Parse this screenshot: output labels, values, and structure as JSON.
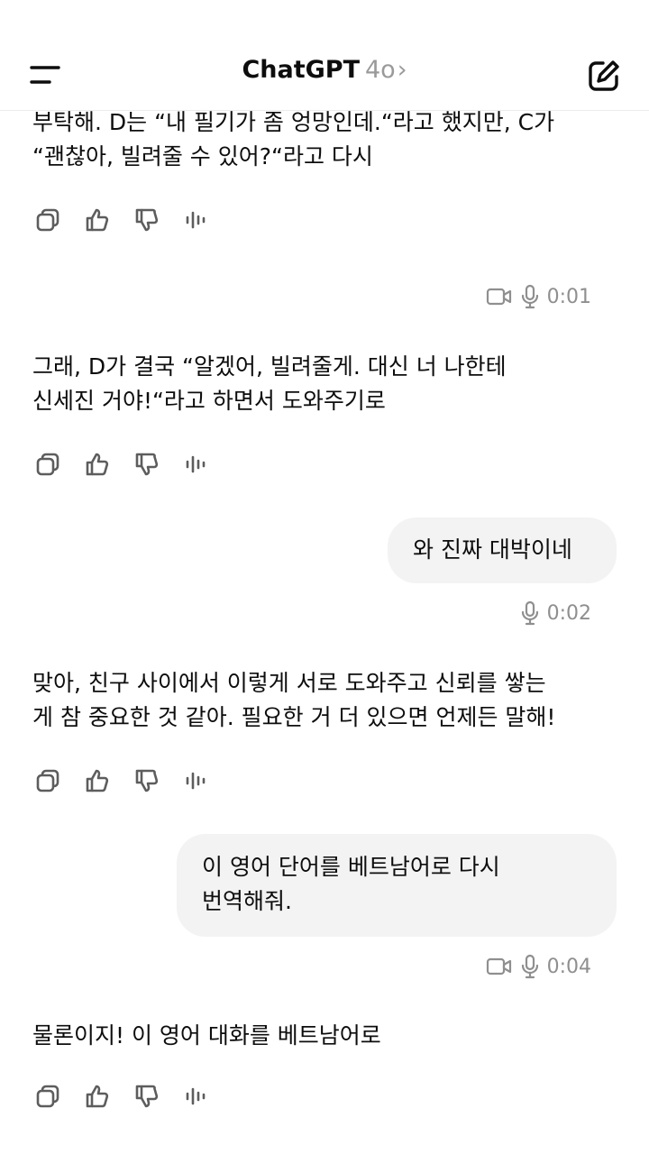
{
  "header": {
    "title": "ChatGPT",
    "model": "4o",
    "chevron": "›"
  },
  "messages": [
    {
      "role": "assistant",
      "text_lines": [
        "부탁해. D는 “내 필기가 좀 엉망인데.“라고 했지만, C가",
        "“괜찮아, 빌려줄 수 있어?“라고 다시"
      ]
    },
    {
      "role": "user_meta",
      "duration": "0:01",
      "has_video_icon": true
    },
    {
      "role": "assistant",
      "text_lines": [
        "그래, D가 결국 “알겠어, 빌려줄게. 대신 너 나한테",
        "신세진 거야!“라고 하면서 도와주기로"
      ]
    },
    {
      "role": "user",
      "text_lines": [
        "와 진짜 대박이네"
      ],
      "duration": "0:02",
      "has_video_icon": false
    },
    {
      "role": "assistant",
      "text_lines": [
        "맞아, 친구 사이에서 이렇게 서로 도와주고 신뢰를 쌓는",
        "게 참 중요한 것 같아. 필요한 거 더 있으면 언제든 말해!"
      ]
    },
    {
      "role": "user",
      "text_lines": [
        "이 영어 단어를 베트남어로 다시",
        "번역해줘."
      ],
      "duration": "0:04",
      "has_video_icon": true
    },
    {
      "role": "assistant",
      "text_lines": [
        "물론이지! 이 영어 대화를 베트남어로"
      ]
    }
  ],
  "icons": [
    "menu-icon",
    "edit-icon",
    "copy-icon",
    "thumbs-up-icon",
    "thumbs-down-icon",
    "voice-icon",
    "video-icon",
    "mic-icon"
  ]
}
